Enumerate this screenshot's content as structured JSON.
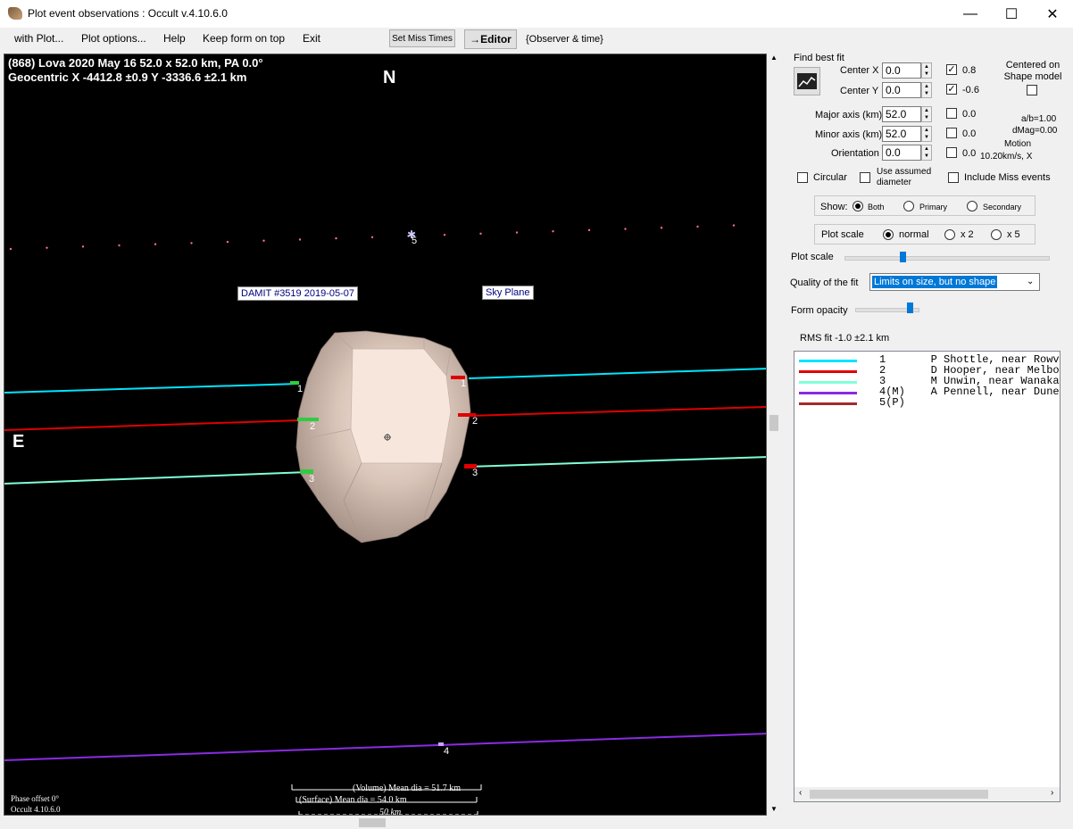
{
  "window": {
    "title": "Plot event observations : Occult v.4.10.6.0",
    "minimize": "—",
    "maximize": "☐",
    "close": "✕"
  },
  "menu": {
    "items": [
      "with Plot...",
      "Plot options...",
      "Help",
      "Keep form on top",
      "Exit"
    ],
    "set_miss_times": "Set Miss Times",
    "editor": "→Editor",
    "observer_time": "{Observer & time}"
  },
  "plot": {
    "header_line1": "(868) Lova  2020 May 16  52.0 x 52.0 km, PA 0.0°",
    "header_line2": "Geocentric  X  -4412.8 ±0.9  Y -3336.6 ±2.1 km",
    "north": "N",
    "east": "E",
    "damit_label": "DAMIT #3519 2019-05-07",
    "sky_plane_label": "Sky Plane",
    "chord_labels": [
      "1",
      "2",
      "3",
      "1",
      "2",
      "3",
      "4",
      "5"
    ],
    "phase_offset": "Phase offset 0°",
    "occult_version": "Occult 4.10.6.0",
    "volume_dia": "(Volume) Mean dia = 51.7 km",
    "surface_dia": "(Surface) Mean dia = 54.0 km",
    "scale_bar": "50 km"
  },
  "panel": {
    "find_best_fit": "Find best fit",
    "center_x_label": "Center X",
    "center_x_value": "0.0",
    "center_x_result": "0.8",
    "center_y_label": "Center Y",
    "center_y_value": "0.0",
    "center_y_result": "-0.6",
    "centered_on_shape": "Centered on Shape model",
    "major_axis_label": "Major axis (km)",
    "major_axis_value": "52.0",
    "major_axis_result": "0.0",
    "minor_axis_label": "Minor axis (km)",
    "minor_axis_value": "52.0",
    "minor_axis_result": "0.0",
    "orientation_label": "Orientation",
    "orientation_value": "0.0",
    "orientation_result": "0.0",
    "ab_ratio": "a/b=1.00",
    "dmag": "dMag=0.00",
    "motion_label": "Motion",
    "motion_value": "10.20km/s, X",
    "circular": "Circular",
    "use_assumed_diameter": "Use assumed diameter",
    "include_miss_events": "Include Miss events",
    "show_label": "Show:",
    "show_options": [
      "Both",
      "Primary",
      "Secondary"
    ],
    "plot_scale_group_label": "Plot scale",
    "plot_scale_options": [
      "normal",
      "x 2",
      "x 5"
    ],
    "plot_scale_slider_label": "Plot scale",
    "plot_scale_slider_level": 0.28,
    "quality_label": "Quality of the fit",
    "quality_value": "Limits on size, but no shape",
    "form_opacity_label": "Form opacity",
    "form_opacity_level": 0.92,
    "rms_fit": "RMS fit -1.0 ±2.1 km"
  },
  "legend": [
    {
      "num": "1",
      "flag": "",
      "observer": "P Shottle, near Rowv",
      "color": "#00e5ff"
    },
    {
      "num": "2",
      "flag": "",
      "observer": "D Hooper, near Melbo",
      "color": "#e00000"
    },
    {
      "num": "3",
      "flag": "",
      "observer": "M Unwin, near Wanaka",
      "color": "#80ffd8"
    },
    {
      "num": "4",
      "flag": "(M)",
      "observer": "A Pennell, near Dune",
      "color": "#8a2be2"
    },
    {
      "num": "5",
      "flag": "(P)",
      "observer": "",
      "color": "#a52a2a"
    }
  ],
  "colors": {
    "chord1": "#00e5ff",
    "chord2": "#e00000",
    "chord3": "#80ffd8",
    "chord4": "#8a2be2",
    "chord5": "#ff6b8a",
    "asteroid_light": "#f3e3da",
    "asteroid_dark": "#9c8a80"
  }
}
